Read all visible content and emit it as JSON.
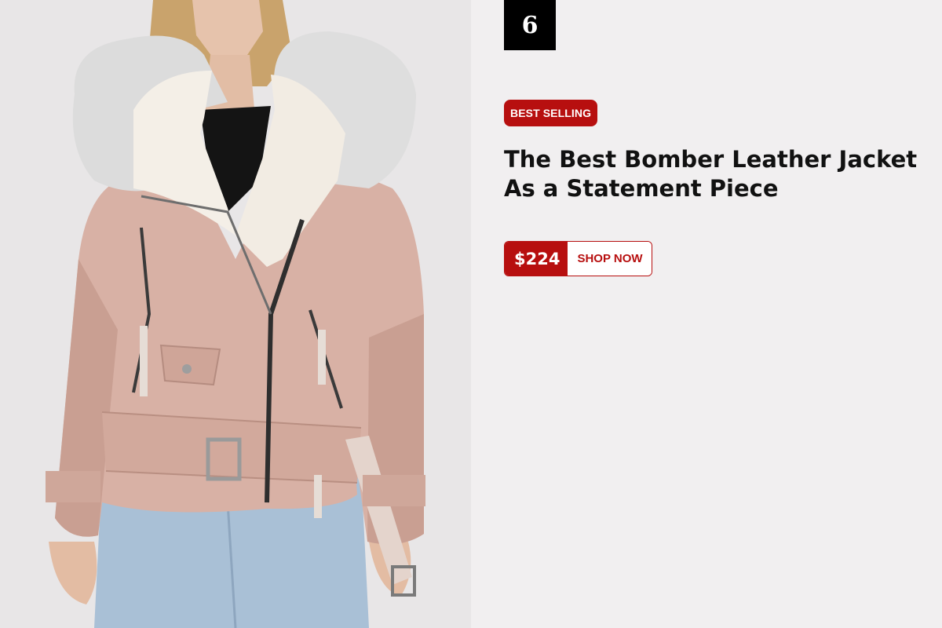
{
  "product": {
    "rank": "6",
    "tag": "BEST SELLING",
    "title": "The Best Bomber Leather Jacket As a Statement Piece",
    "price": "$224",
    "cta_label": "SHOP NOW",
    "image_alt": "Model wearing pink croc-embossed leather jacket with white fur collar"
  },
  "colors": {
    "accent": "#b70f0f",
    "background": "#f1eff0",
    "jacket": "#d9b3a7"
  }
}
